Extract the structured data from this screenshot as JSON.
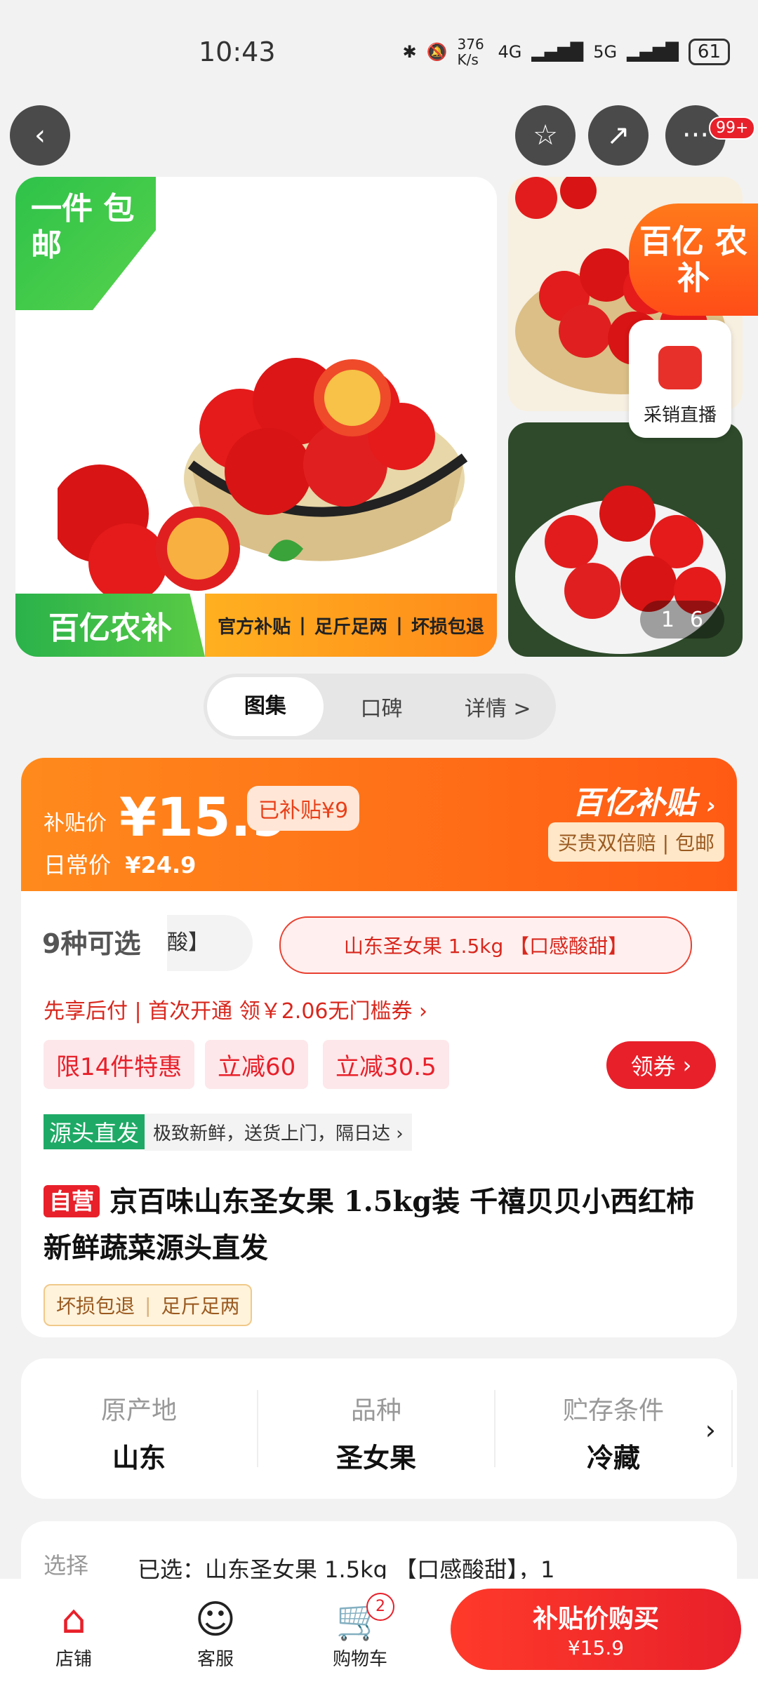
{
  "status_bar": {
    "time": "10:43",
    "net_speed": "376 K/s",
    "sig1": "4G",
    "sig2": "5G",
    "battery": "61"
  },
  "header": {
    "back_icon": "back-icon",
    "fav_icon": "star-icon",
    "share_icon": "share-icon",
    "more_icon": "more-icon",
    "more_badge": "99+"
  },
  "gallery": {
    "ribbon_text": "一件 包邮",
    "banner_brand": "百亿农补",
    "banner_items": [
      "官方补贴",
      "足斤足两",
      "坏损包退"
    ],
    "brand_badge": "百亿 农补",
    "live_label": "采销直播",
    "counter_current": "1",
    "counter_total": "6"
  },
  "tabs": [
    "图集",
    "口碑",
    "详情 >"
  ],
  "price": {
    "sub_label": "补贴价",
    "sub_price": "¥15.9",
    "subsidized": "已补贴¥9",
    "daily_label": "日常价",
    "daily_price": "¥24.9",
    "brand": "百亿补贴",
    "guarantee": "买贵双倍赔 | 包邮"
  },
  "options": {
    "count": "9种可选",
    "partial": "酸】",
    "selected": "山东圣女果 1.5kg 【口感酸甜】"
  },
  "pay_line": "先享后付 | 首次开通 领￥2.06无门槛券 ›",
  "promos": [
    "限14件特惠",
    "立减60",
    "立减30.5"
  ],
  "coupon": "领券",
  "source": {
    "label": "源头直发",
    "text": "极致新鲜，送货上门，隔日达 ›"
  },
  "product": {
    "self_op": "自营",
    "title": "京百味山东圣女果 1.5kg装 千禧贝贝小西红柿 新鲜蔬菜源头直发",
    "tags": [
      "坏损包退",
      "足斤足两"
    ]
  },
  "attributes": [
    {
      "label": "原产地",
      "value": "山东"
    },
    {
      "label": "品种",
      "value": "圣女果"
    },
    {
      "label": "贮存条件",
      "value": "冷藏"
    }
  ],
  "select": {
    "label": "选择",
    "value": "已选：山东圣女果 1.5kg 【口感酸甜】，1"
  },
  "bottom_nav": {
    "store": "店铺",
    "service": "客服",
    "cart": "购物车",
    "cart_count": "2",
    "buy_label": "补贴价购买",
    "buy_price": "¥15.9"
  }
}
